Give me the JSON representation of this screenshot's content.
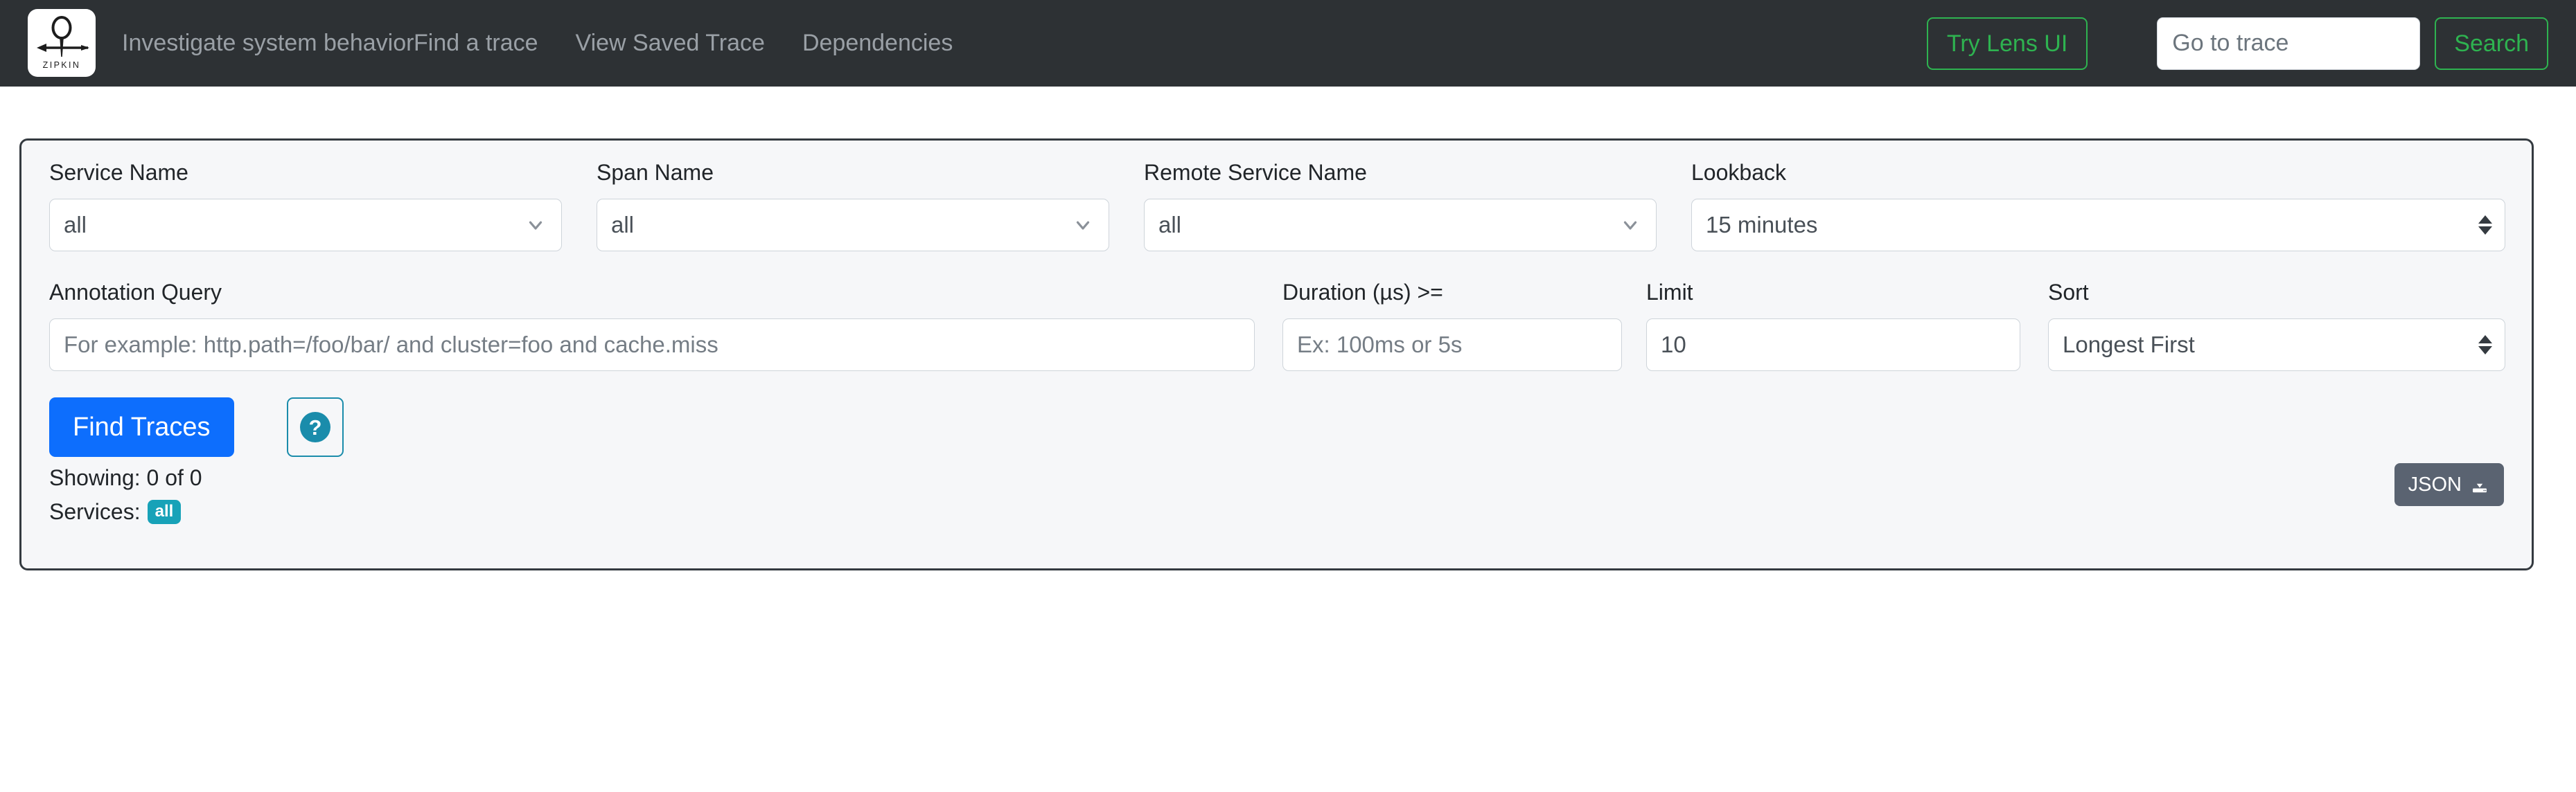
{
  "navbar": {
    "logo_icon": "zipkin-logo-icon",
    "logo_text": "ZIPKIN",
    "tagline": "Investigate system behavior",
    "links": [
      {
        "label": "Find a trace"
      },
      {
        "label": "View Saved Trace"
      },
      {
        "label": "Dependencies"
      }
    ],
    "lens_button": "Try Lens UI",
    "trace_input_placeholder": "Go to trace",
    "trace_input_value": "",
    "search_button": "Search",
    "background_color": "#2d3134",
    "accent_green": "#2eb350"
  },
  "search_form": {
    "service_name": {
      "label": "Service Name",
      "value": "all",
      "icon": "chevron-down-icon"
    },
    "span_name": {
      "label": "Span Name",
      "value": "all",
      "icon": "chevron-down-icon"
    },
    "remote_service_name": {
      "label": "Remote Service Name",
      "value": "all",
      "icon": "chevron-down-icon"
    },
    "lookback": {
      "label": "Lookback",
      "value": "15 minutes",
      "icon": "select-spinner-icon"
    },
    "annotation_query": {
      "label": "Annotation Query",
      "placeholder": "For example: http.path=/foo/bar/ and cluster=foo and cache.miss",
      "value": ""
    },
    "duration": {
      "label": "Duration (µs) >=",
      "placeholder": "Ex: 100ms or 5s",
      "value": ""
    },
    "limit": {
      "label": "Limit",
      "value": "10",
      "placeholder": ""
    },
    "sort": {
      "label": "Sort",
      "value": "Longest First",
      "icon": "select-spinner-icon"
    },
    "find_traces_button": "Find Traces",
    "help_button_icon": "question-mark-icon",
    "help_button_glyph": "?",
    "showing_text": "Showing: 0 of 0",
    "services_label": "Services:",
    "services_badge": "all",
    "json_button": "JSON",
    "json_button_icon": "download-icon",
    "primary_button_color": "#0d6efd",
    "badge_color": "#17a2b8",
    "help_accent_color": "#1a8cab",
    "json_button_color": "#5a6371"
  }
}
